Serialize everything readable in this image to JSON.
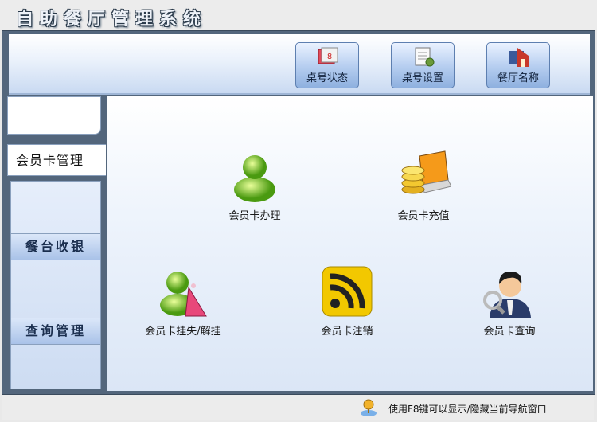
{
  "app": {
    "title": "自助餐厅管理系统"
  },
  "toolbar": {
    "buttons": [
      {
        "label": "桌号状态",
        "icon": "table-status-icon"
      },
      {
        "label": "桌号设置",
        "icon": "table-settings-icon"
      },
      {
        "label": "餐厅名称",
        "icon": "restaurant-name-icon"
      }
    ]
  },
  "sidebar": {
    "active_tab": "会员卡管理",
    "sections": [
      "餐台收银",
      "查询管理"
    ]
  },
  "main": {
    "features": [
      {
        "label": "会员卡办理",
        "icon": "member-user-icon"
      },
      {
        "label": "会员卡充值",
        "icon": "coins-laptop-icon"
      },
      {
        "label": "会员卡挂失/解挂",
        "icon": "user-bag-icon"
      },
      {
        "label": "会员卡注销",
        "icon": "rss-feed-icon"
      },
      {
        "label": "会员卡查询",
        "icon": "user-search-icon"
      }
    ]
  },
  "status": {
    "hint": "使用F8键可以显示/隐藏当前导航窗口"
  },
  "colors": {
    "frame": "#53667c",
    "accent": "#8eb0df"
  }
}
